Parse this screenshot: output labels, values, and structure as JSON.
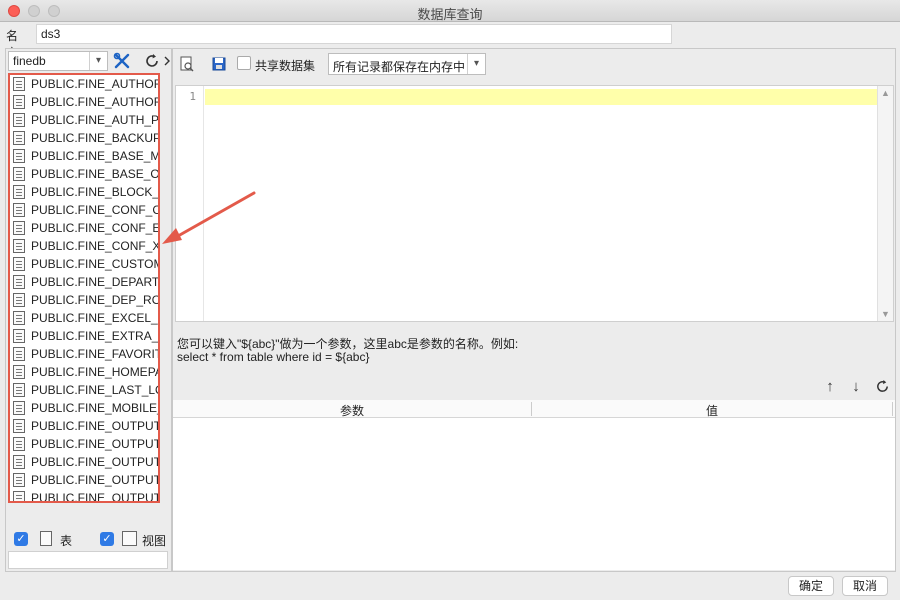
{
  "window": {
    "title": "数据库查询"
  },
  "name_field": {
    "label": "名字:",
    "value": "ds3"
  },
  "left": {
    "database": "finedb",
    "tables": [
      "PUBLIC.FINE_AUTHORI",
      "PUBLIC.FINE_AUTHORI",
      "PUBLIC.FINE_AUTH_PR",
      "PUBLIC.FINE_BACKUP_",
      "PUBLIC.FINE_BASE_ME",
      "PUBLIC.FINE_BASE_OU",
      "PUBLIC.FINE_BLOCK_IP",
      "PUBLIC.FINE_CONF_CL",
      "PUBLIC.FINE_CONF_EN",
      "PUBLIC.FINE_CONF_XM",
      "PUBLIC.FINE_CUSTOM_",
      "PUBLIC.FINE_DEPARTM",
      "PUBLIC.FINE_DEP_ROL",
      "PUBLIC.FINE_EXCEL_SU",
      "PUBLIC.FINE_EXTRA_P",
      "PUBLIC.FINE_FAVORIT",
      "PUBLIC.FINE_HOMEPAG",
      "PUBLIC.FINE_LAST_LOG",
      "PUBLIC.FINE_MOBILE_F",
      "PUBLIC.FINE_OUTPUT_",
      "PUBLIC.FINE_OUTPUT_",
      "PUBLIC.FINE_OUTPUT_",
      "PUBLIC.FINE_OUTPUT_",
      "PUBLIC.FINE_OUTPUT_"
    ],
    "filter_table_label": "表",
    "filter_view_label": "视图",
    "filter_table_checked": true,
    "filter_view_checked": true
  },
  "toolbar": {
    "share_dataset_label": "共享数据集",
    "share_dataset_checked": false,
    "memory_option": "所有记录都保存在内存中"
  },
  "editor": {
    "line_number": "1"
  },
  "hint": {
    "line1": "您可以键入\"${abc}\"做为一个参数，这里abc是参数的名称。例如:",
    "line2": "select * from table where id = ${abc}"
  },
  "params_table": {
    "col_param": "参数",
    "col_value": "值"
  },
  "buttons": {
    "ok": "确定",
    "cancel": "取消"
  },
  "colors": {
    "highlight_border": "#e35a4a",
    "current_line": "#ffffaa",
    "checkbox": "#2f7ae5"
  }
}
